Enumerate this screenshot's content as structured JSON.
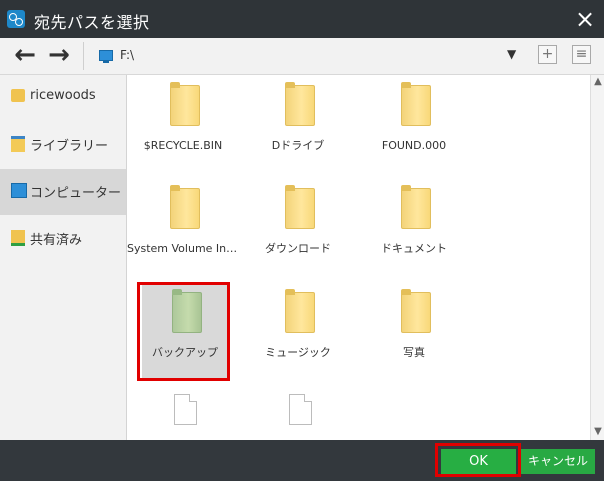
{
  "window": {
    "title": "宛先パスを選択",
    "close_label": "×"
  },
  "toolbar": {
    "back_label": "←",
    "forward_label": "→",
    "path": "F:\\",
    "dropdown_label": "▼",
    "new_folder_label": "+",
    "view_label": "≡"
  },
  "sidebar": {
    "items": [
      {
        "label": "ricewoods",
        "icon": "user-folder-icon"
      },
      {
        "label": "ライブラリー",
        "icon": "library-icon"
      },
      {
        "label": "コンピューター",
        "icon": "computer-icon",
        "selected": true
      },
      {
        "label": "共有済み",
        "icon": "shared-icon"
      }
    ]
  },
  "files": [
    {
      "label": "$RECYCLE.BIN",
      "type": "folder"
    },
    {
      "label": "Dドライブ",
      "type": "folder"
    },
    {
      "label": "FOUND.000",
      "type": "folder"
    },
    {
      "label": "System Volume Infor...",
      "type": "folder"
    },
    {
      "label": "ダウンロード",
      "type": "folder"
    },
    {
      "label": "ドキュメント",
      "type": "folder"
    },
    {
      "label": "バックアップ",
      "type": "folder",
      "selected": true
    },
    {
      "label": "ミュージック",
      "type": "folder"
    },
    {
      "label": "写真",
      "type": "folder"
    },
    {
      "label": "",
      "type": "file"
    },
    {
      "label": "",
      "type": "file"
    }
  ],
  "scrollbar": {
    "up_label": "▲",
    "down_label": "▼"
  },
  "footer": {
    "ok_label": "OK",
    "cancel_label": "キャンセル"
  },
  "colors": {
    "titlebar": "#2f3438",
    "accent": "#27ae43",
    "highlight": "#e10000",
    "sidebar_active": "#d7d7d7"
  }
}
